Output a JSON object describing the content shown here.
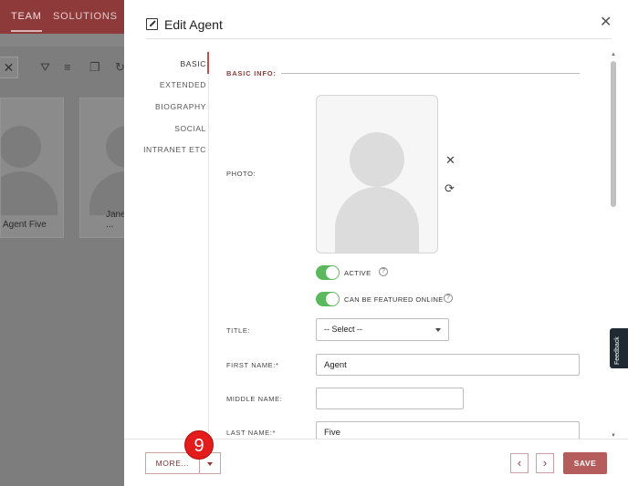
{
  "background": {
    "tabs": [
      "TEAM",
      "SOLUTIONS"
    ],
    "cards": [
      {
        "name": "Agent Five"
      },
      {
        "name": "Jane ..."
      }
    ]
  },
  "modal": {
    "title": "Edit Agent",
    "nav": [
      "BASIC",
      "EXTENDED",
      "BIOGRAPHY",
      "SOCIAL",
      "INTRANET ETC"
    ],
    "section_label": "BASIC INFO:",
    "photo_label": "PHOTO:",
    "toggles": [
      {
        "label": "ACTIVE",
        "on": true
      },
      {
        "label": "CAN BE FEATURED ONLINE",
        "on": true
      }
    ],
    "title_field": {
      "label": "TITLE:",
      "value": "-- Select --"
    },
    "first_name": {
      "label": "FIRST NAME:*",
      "value": "Agent"
    },
    "middle_name": {
      "label": "MIDDLE NAME:",
      "value": ""
    },
    "last_name": {
      "label": "LAST NAME:*",
      "value": "Five"
    }
  },
  "footer": {
    "more_label": "MORE...",
    "badge": "9",
    "prev_glyph": "‹",
    "next_glyph": "›",
    "save_label": "SAVE"
  },
  "feedback_label": "Feedback",
  "colors": {
    "brand": "#8f3a3a",
    "toggle_on": "#5cb85c",
    "save": "#b55c5c",
    "badge": "#e31b1b"
  }
}
